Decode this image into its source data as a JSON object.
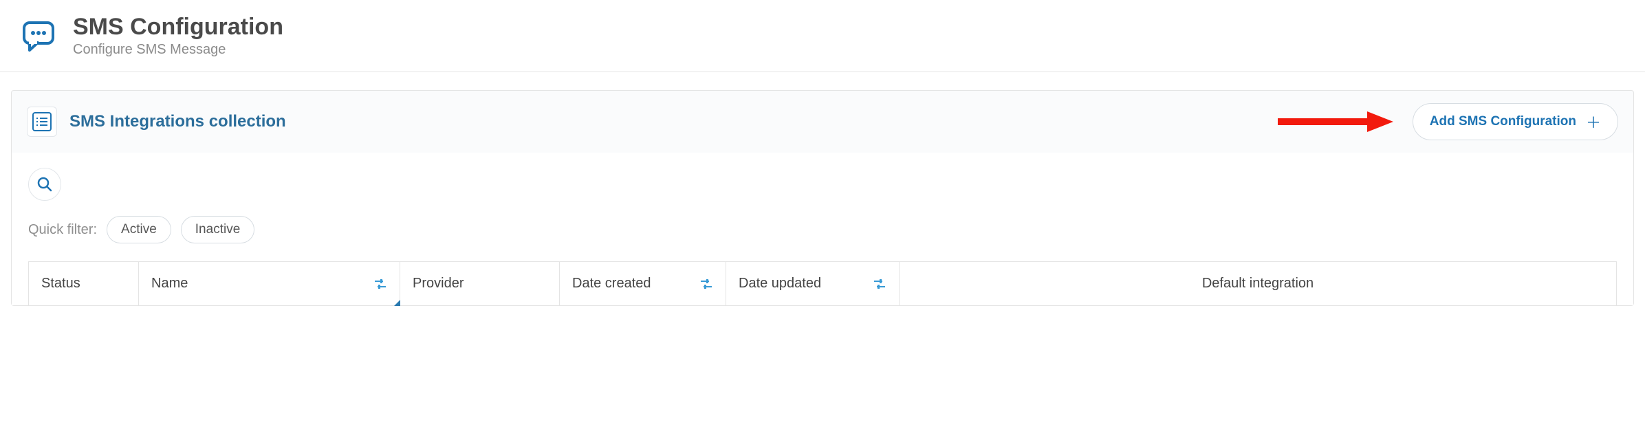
{
  "header": {
    "title": "SMS Configuration",
    "subtitle": "Configure SMS Message"
  },
  "panel": {
    "title": "SMS Integrations collection",
    "add_button_label": "Add SMS Configuration"
  },
  "filters": {
    "label": "Quick filter:",
    "options": [
      "Active",
      "Inactive"
    ]
  },
  "table": {
    "columns": [
      {
        "key": "status",
        "label": "Status",
        "filterable": false
      },
      {
        "key": "name",
        "label": "Name",
        "filterable": true
      },
      {
        "key": "provider",
        "label": "Provider",
        "filterable": false
      },
      {
        "key": "created",
        "label": "Date created",
        "filterable": true
      },
      {
        "key": "updated",
        "label": "Date updated",
        "filterable": true
      },
      {
        "key": "default",
        "label": "Default integration",
        "filterable": false
      }
    ],
    "rows": []
  },
  "icons": {
    "sms": "sms-bubble-icon",
    "collection": "list-icon",
    "search": "search-icon",
    "column_filter": "filter-icon",
    "plus": "plus-icon"
  },
  "colors": {
    "accent_blue": "#1d73b3",
    "header_blue": "#2c6e9b",
    "annotation_red": "#f21a0d"
  }
}
